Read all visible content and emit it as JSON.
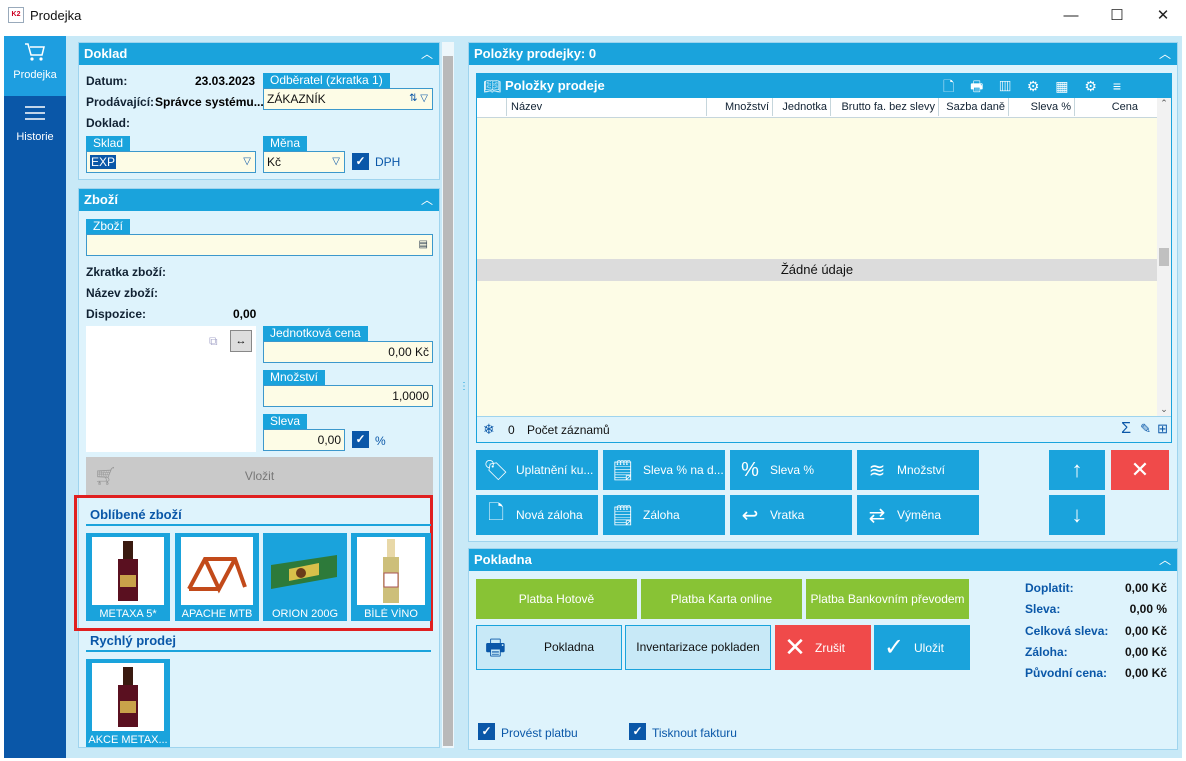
{
  "window": {
    "title": "Prodejka",
    "icon_text": "K2",
    "min": "—",
    "max": "☐",
    "close": "✕"
  },
  "nav": [
    {
      "label": "Prodejka",
      "icon": "cart-icon"
    },
    {
      "label": "Historie",
      "icon": "menu-icon"
    }
  ],
  "doklad": {
    "header": "Doklad",
    "datum_label": "Datum:",
    "datum_value": "23.03.2023",
    "prodavajici_label": "Prodávající:",
    "prodavajici_value": "Správce systému...",
    "doklad_label": "Doklad:",
    "odberatel_label": "Odběratel (zkratka 1)",
    "odberatel_value": "ZÁKAZNÍK",
    "sklad_label": "Sklad",
    "sklad_value": "EXP",
    "mena_label": "Měna",
    "mena_value": "Kč",
    "dph_label": "DPH"
  },
  "zbozi": {
    "header": "Zboží",
    "zbozi_label": "Zboží",
    "zbozi_value": "",
    "zkratka_label": "Zkratka zboží:",
    "nazev_label": "Název zboží:",
    "dispozice_label": "Dispozice:",
    "dispozice_value": "0,00",
    "jednotkova_cena_label": "Jednotková cena",
    "jednotkova_cena_value": "0,00 Kč",
    "mnozstvi_label": "Množství",
    "mnozstvi_value": "1,0000",
    "sleva_label": "Sleva",
    "sleva_value": "0,00",
    "sleva_unit": "%",
    "vlozit_label": "Vložit"
  },
  "oblibene": {
    "header": "Oblíbené zboží",
    "items": [
      {
        "name": "METAXA 5*"
      },
      {
        "name": "APACHE MTB"
      },
      {
        "name": "ORION 200G"
      },
      {
        "name": "BÍLÉ VÍNO"
      }
    ]
  },
  "rychly": {
    "header": "Rychlý prodej",
    "items": [
      {
        "name": "AKCE METAX..."
      }
    ]
  },
  "polozky": {
    "header": "Položky prodejky: 0",
    "grid_title": "Položky prodeje",
    "columns": [
      "Název",
      "Množství",
      "Jednotka",
      "Brutto fa. bez slevy",
      "Sazba daně",
      "Sleva %",
      "Cena"
    ],
    "empty_text": "Žádné údaje",
    "count": "0",
    "count_label": "Počet záznamů"
  },
  "actions": {
    "uplatneni": "Uplatnění ku...",
    "sleva_na_doklad": "Sleva % na d...",
    "sleva_pct": "Sleva %",
    "mnozstvi": "Množství",
    "nova_zaloha": "Nová záloha",
    "zaloha": "Záloha",
    "vratka": "Vratka",
    "vymena": "Výměna"
  },
  "pokladna": {
    "header": "Pokladna",
    "platba_hotove": "Platba Hotově",
    "platba_karta": "Platba Karta online",
    "platba_bank": "Platba Bankovním převodem",
    "pokladna_btn": "Pokladna",
    "inventarizace": "Inventarizace pokladen",
    "zrusit": "Zrušit",
    "ulozit": "Uložit",
    "provest_platbu": "Provést platbu",
    "tisknout_fakturu": "Tisknout fakturu",
    "summary": [
      {
        "label": "Doplatit:",
        "value": "0,00 Kč"
      },
      {
        "label": "Sleva:",
        "value": "0,00 %"
      },
      {
        "label": "Celková sleva:",
        "value": "0,00 Kč"
      },
      {
        "label": "Záloha:",
        "value": "0,00 Kč"
      },
      {
        "label": "Původní cena:",
        "value": "0,00 Kč"
      }
    ]
  },
  "colors": {
    "accent": "#1aa3dc",
    "nav": "#0a57a8",
    "green": "#88c335",
    "red": "#f04a4a",
    "highlight": "#e02020"
  }
}
